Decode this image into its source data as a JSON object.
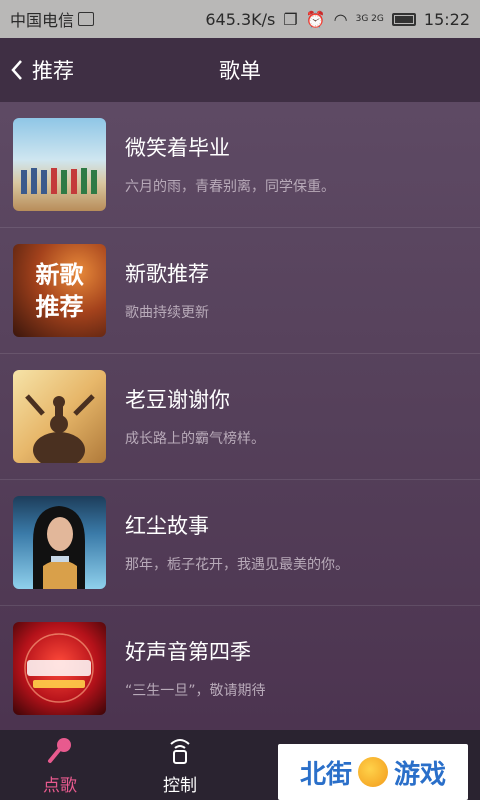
{
  "status_bar": {
    "carrier": "中国电信",
    "speed": "645.3K/s",
    "network": "3G 2G",
    "time": "15:22"
  },
  "header": {
    "back_label": "推荐",
    "title": "歌单"
  },
  "playlists": [
    {
      "title": "微笑着毕业",
      "subtitle": "六月的雨，青春别离，同学保重。",
      "thumb_text": []
    },
    {
      "title": "新歌推荐",
      "subtitle": "歌曲持续更新",
      "thumb_text": [
        "新歌",
        "推荐"
      ]
    },
    {
      "title": "老豆谢谢你",
      "subtitle": "成长路上的霸气榜样。",
      "thumb_text": []
    },
    {
      "title": "红尘故事",
      "subtitle": "那年，栀子花开，我遇见最美的你。",
      "thumb_text": []
    },
    {
      "title": "好声音第四季",
      "subtitle": "“三生一旦”，敬请期待",
      "thumb_text": []
    }
  ],
  "bottom_nav": {
    "items": [
      {
        "label": "点歌",
        "icon": "microphone-icon",
        "active": true
      },
      {
        "label": "控制",
        "icon": "remote-control-icon",
        "active": false
      },
      {
        "label": "",
        "icon": "playlist-icon",
        "active": false
      },
      {
        "label": "",
        "icon": "profile-icon",
        "active": false
      }
    ]
  },
  "watermark": {
    "text_left": "北街",
    "text_right": "游戏"
  },
  "colors": {
    "accent": "#e85a8e",
    "background": "#4d3950",
    "header": "#3f2f44",
    "nav": "#2a2330"
  }
}
